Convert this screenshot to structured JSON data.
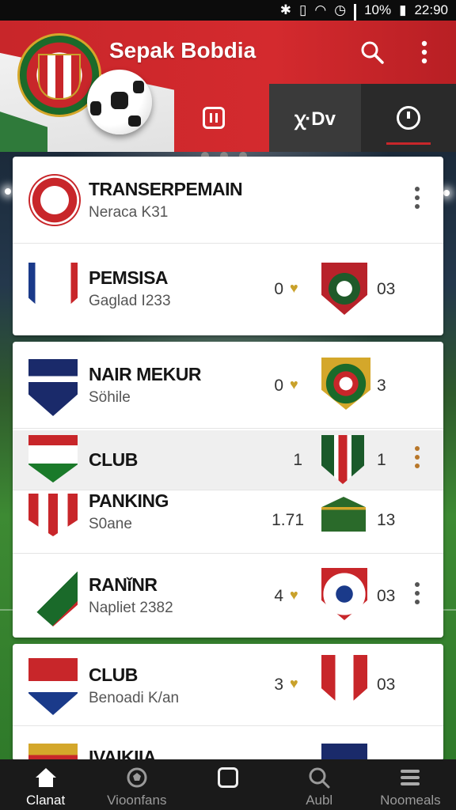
{
  "status_bar": {
    "battery": "10%",
    "time": "22:90"
  },
  "header": {
    "title": "Sepak Bobdia",
    "icons": [
      "search-icon",
      "more-vert-icon"
    ],
    "tabs": [
      {
        "label": "",
        "icon": "calendar-icon"
      },
      {
        "label": "ꭓ·Dv",
        "icon": ""
      },
      {
        "label": "",
        "icon": "timer-icon"
      }
    ],
    "accent": "#c8262a"
  },
  "rows": [
    {
      "title": "TRANSERPEMAIN",
      "subtitle": "Neraca K31",
      "score_left": "",
      "score_right": "",
      "crest_colors": [
        "#c8262a",
        "#ffffff"
      ]
    },
    {
      "title": "PEMSISA",
      "subtitle": "Gaglad I233",
      "score_left": "0",
      "score_right": "03",
      "crest_colors": [
        "#c8262a",
        "#1a3a8a"
      ],
      "opp_colors": [
        "#b8222a",
        "#1f5a2a"
      ]
    },
    {
      "title": "NAIR MEKUR",
      "subtitle": "Söhile",
      "score_left": "0",
      "score_right": "3",
      "crest_colors": [
        "#1a2a6a",
        "#d4a72a"
      ],
      "opp_colors": [
        "#1a6a2a",
        "#c8262a"
      ]
    },
    {
      "title": "CLUB",
      "subtitle": "",
      "score_left": "1",
      "score_right": "1",
      "crest_colors": [
        "#c8262a",
        "#1a7a2a"
      ],
      "opp_colors": [
        "#1a5a2a",
        "#c8262a"
      ]
    },
    {
      "title": "PANKING",
      "subtitle": "S0ane",
      "score_left": "1.71",
      "score_right": "13",
      "crest_colors": [
        "#c8262a",
        "#d4a72a"
      ],
      "opp_colors": [
        "#2a6a2a",
        "#d4a72a"
      ]
    },
    {
      "title": "RANǐNR",
      "subtitle": "Napliet 2382",
      "score_left": "4",
      "score_right": "03",
      "crest_colors": [
        "#1a6a2a",
        "#c8262a"
      ],
      "opp_colors": [
        "#c8262a",
        "#1a3a8a"
      ]
    },
    {
      "title": "CLUB",
      "subtitle": "Benoadi K/an",
      "score_left": "3",
      "score_right": "03",
      "crest_colors": [
        "#c8262a",
        "#1a3a8a"
      ],
      "opp_colors": [
        "#c8262a",
        "#ffffff"
      ]
    },
    {
      "title": "IVAIKIIA",
      "subtitle": "",
      "score_left": "",
      "score_right": "",
      "crest_colors": [
        "#c8262a",
        "#d4a72a"
      ],
      "opp_colors": [
        "#1a2a6a",
        "#c8262a"
      ]
    }
  ],
  "bottom_nav": [
    {
      "label": "Clanat",
      "icon": "home-icon",
      "active": true
    },
    {
      "label": "Vioonfans",
      "icon": "ball-icon",
      "active": false
    },
    {
      "label": "",
      "icon": "square-icon",
      "active": false
    },
    {
      "label": "Aubl",
      "icon": "search-icon",
      "active": false
    },
    {
      "label": "Noomeals",
      "icon": "menu-icon",
      "active": false
    }
  ]
}
